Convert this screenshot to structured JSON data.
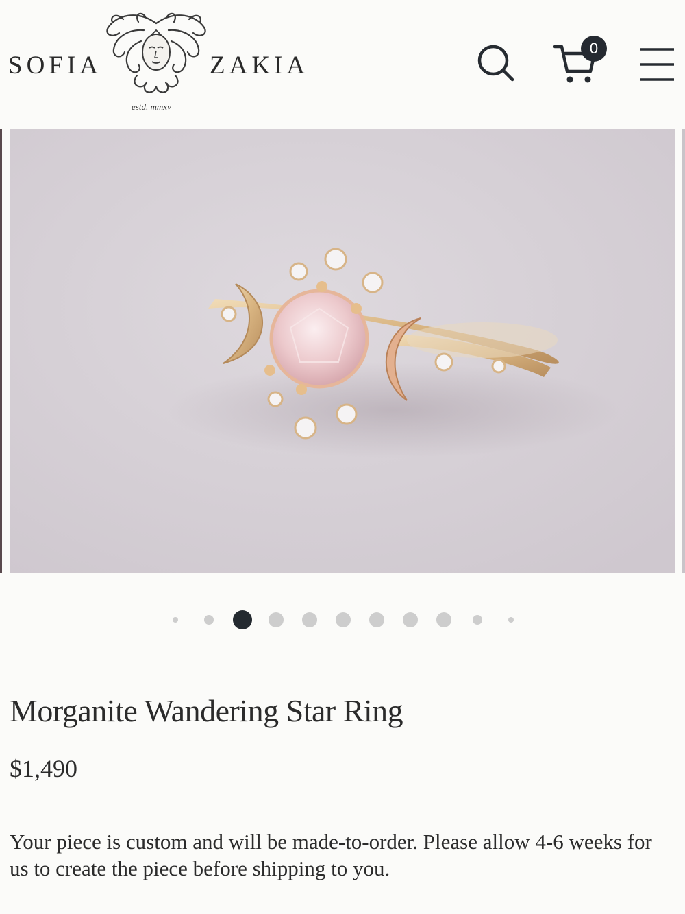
{
  "header": {
    "brand_left": "SOFIA",
    "brand_right": "ZAKIA",
    "tagline": "estd. mmxv",
    "cart_count": "0",
    "icons": [
      "medusa-logo-icon",
      "search-icon",
      "cart-icon",
      "hamburger-menu-icon"
    ]
  },
  "gallery": {
    "image_alt": "Morganite Wandering Star Ring photo",
    "dot_count": 11,
    "active_dot_index": 2,
    "colors": {
      "active_dot": "#242a30",
      "inactive_dot": "#cdcdcd",
      "backdrop": "#d9d4da"
    }
  },
  "product": {
    "title": "Morganite Wandering Star Ring",
    "price": "$1,490",
    "note": "Your piece is custom and will be made-to-order. Please allow 4-6 weeks for us to create the piece before shipping to you."
  }
}
